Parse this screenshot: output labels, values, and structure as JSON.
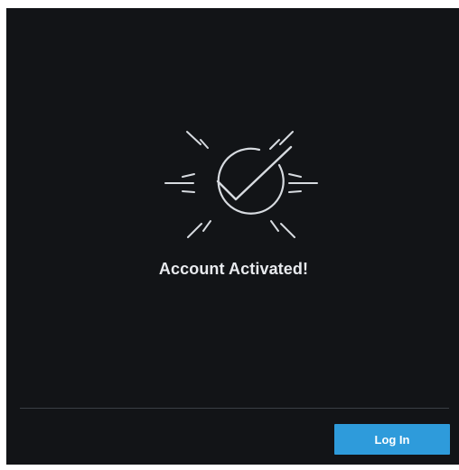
{
  "dialog": {
    "icon": "check-circle-burst-icon",
    "title": "Account Activated!",
    "login_button_label": "Log In"
  },
  "colors": {
    "background": "#121417",
    "text": "#e8eaee",
    "icon": "#d7dbe0",
    "accent": "#2e9bdb",
    "divider": "#3a3f45"
  }
}
